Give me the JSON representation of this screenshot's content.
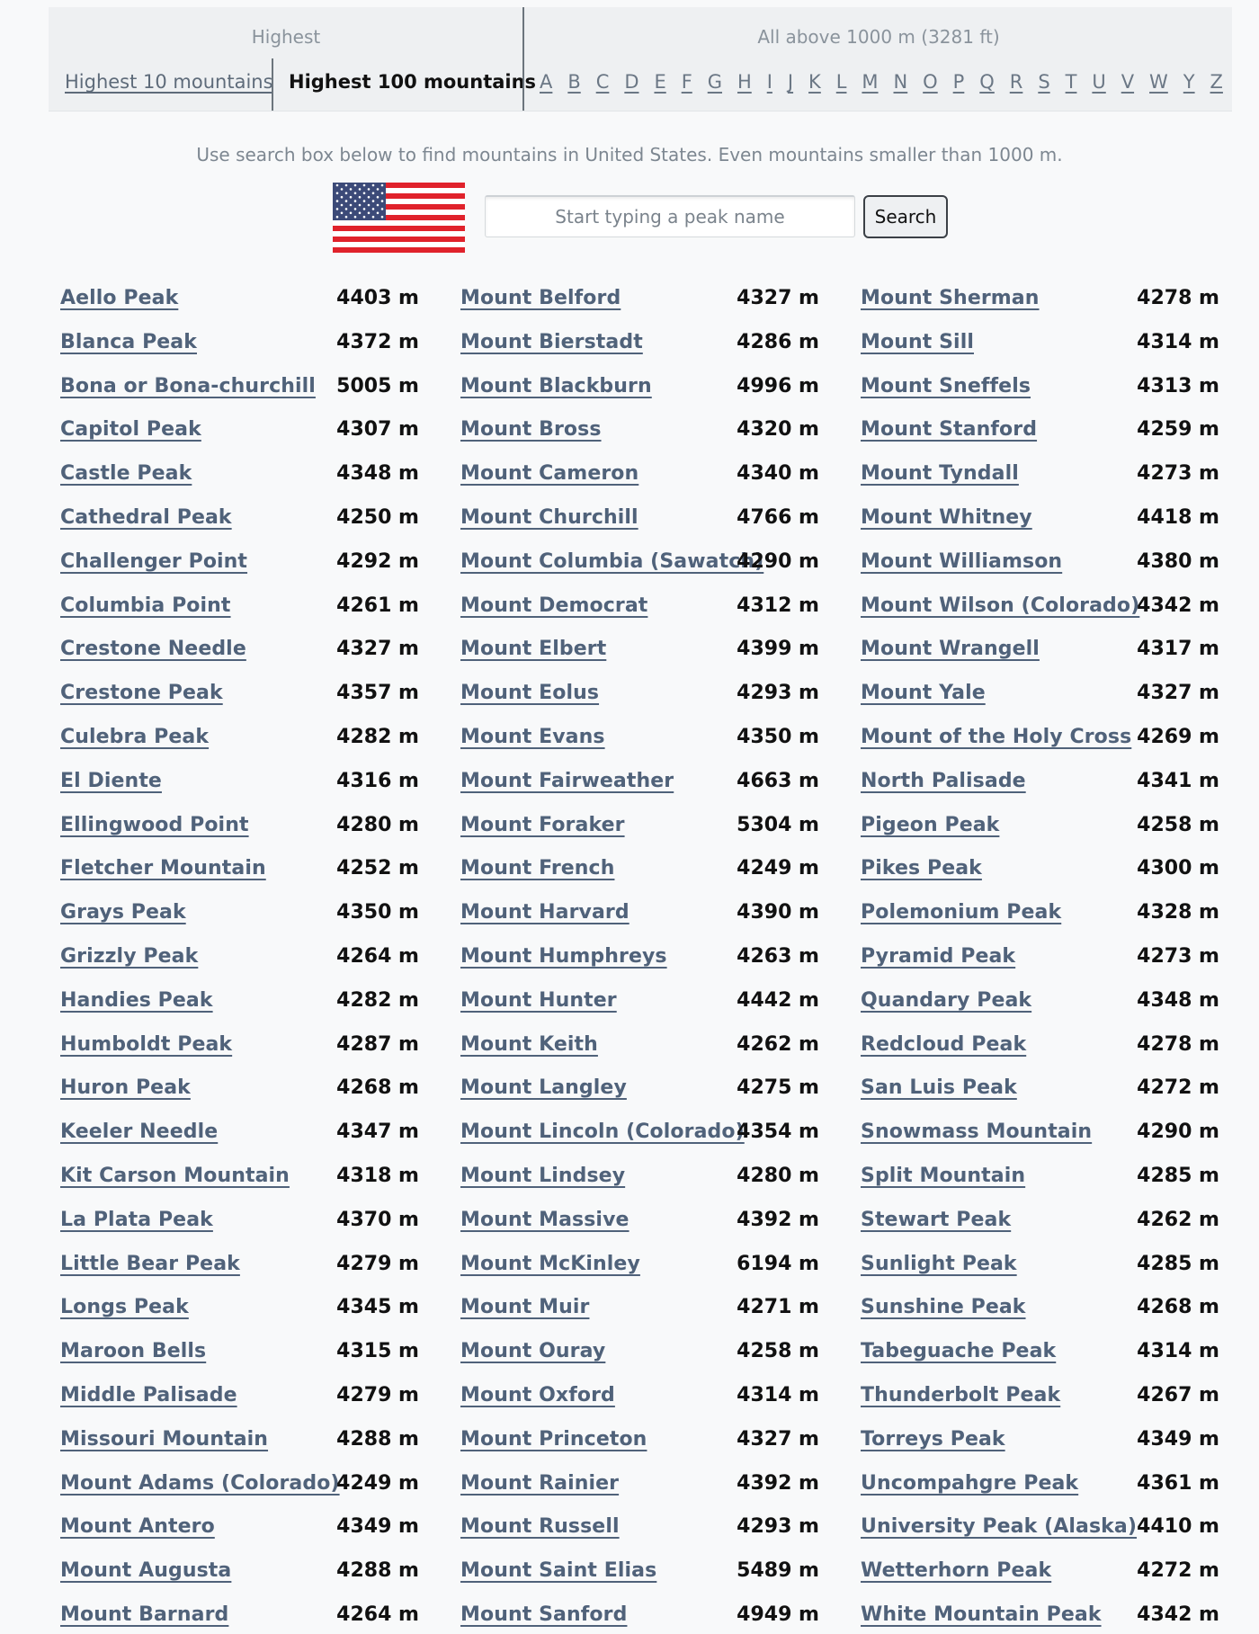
{
  "nav": {
    "highest_title": "Highest",
    "tab_top10": "Highest 10 mountains",
    "tab_top100": "Highest 100 mountains",
    "all_above_title": "All above 1000 m (3281 ft)",
    "letters": [
      "A",
      "B",
      "C",
      "D",
      "E",
      "F",
      "G",
      "H",
      "I",
      "J",
      "K",
      "L",
      "M",
      "N",
      "O",
      "P",
      "Q",
      "R",
      "S",
      "T",
      "U",
      "V",
      "W",
      "Y",
      "Z"
    ]
  },
  "search": {
    "hint": "Use search box below to find mountains in United States. Even mountains smaller than 1000 m.",
    "placeholder": "Start typing a peak name",
    "button_label": "Search"
  },
  "colors": {
    "link": "#50627a",
    "flag_red": "#e0222b",
    "flag_blue": "#3c4a78"
  },
  "columns": [
    [
      {
        "name": "Aello Peak",
        "height": "4403 m"
      },
      {
        "name": "Blanca Peak",
        "height": "4372 m"
      },
      {
        "name": "Bona or Bona-churchill",
        "height": "5005 m"
      },
      {
        "name": "Capitol Peak",
        "height": "4307 m"
      },
      {
        "name": "Castle Peak",
        "height": "4348 m"
      },
      {
        "name": "Cathedral Peak",
        "height": "4250 m"
      },
      {
        "name": "Challenger Point",
        "height": "4292 m"
      },
      {
        "name": "Columbia Point",
        "height": "4261 m"
      },
      {
        "name": "Crestone Needle",
        "height": "4327 m"
      },
      {
        "name": "Crestone Peak",
        "height": "4357 m"
      },
      {
        "name": "Culebra Peak",
        "height": "4282 m"
      },
      {
        "name": "El Diente",
        "height": "4316 m"
      },
      {
        "name": "Ellingwood Point",
        "height": "4280 m"
      },
      {
        "name": "Fletcher Mountain",
        "height": "4252 m"
      },
      {
        "name": "Grays Peak",
        "height": "4350 m"
      },
      {
        "name": "Grizzly Peak",
        "height": "4264 m"
      },
      {
        "name": "Handies Peak",
        "height": "4282 m"
      },
      {
        "name": "Humboldt Peak",
        "height": "4287 m"
      },
      {
        "name": "Huron Peak",
        "height": "4268 m"
      },
      {
        "name": "Keeler Needle",
        "height": "4347 m"
      },
      {
        "name": "Kit Carson Mountain",
        "height": "4318 m"
      },
      {
        "name": "La Plata Peak",
        "height": "4370 m"
      },
      {
        "name": "Little Bear Peak",
        "height": "4279 m"
      },
      {
        "name": "Longs Peak",
        "height": "4345 m"
      },
      {
        "name": "Maroon Bells",
        "height": "4315 m"
      },
      {
        "name": "Middle Palisade",
        "height": "4279 m"
      },
      {
        "name": "Missouri Mountain",
        "height": "4288 m"
      },
      {
        "name": "Mount Adams (Colorado)",
        "height": "4249 m"
      },
      {
        "name": "Mount Antero",
        "height": "4349 m"
      },
      {
        "name": "Mount Augusta",
        "height": "4288 m"
      },
      {
        "name": "Mount Barnard",
        "height": "4264 m"
      }
    ],
    [
      {
        "name": "Mount Belford",
        "height": "4327 m"
      },
      {
        "name": "Mount Bierstadt",
        "height": "4286 m"
      },
      {
        "name": "Mount Blackburn",
        "height": "4996 m"
      },
      {
        "name": "Mount Bross",
        "height": "4320 m"
      },
      {
        "name": "Mount Cameron",
        "height": "4340 m"
      },
      {
        "name": "Mount Churchill",
        "height": "4766 m"
      },
      {
        "name": "Mount Columbia (Sawatch)",
        "height": "4290 m"
      },
      {
        "name": "Mount Democrat",
        "height": "4312 m"
      },
      {
        "name": "Mount Elbert",
        "height": "4399 m"
      },
      {
        "name": "Mount Eolus",
        "height": "4293 m"
      },
      {
        "name": "Mount Evans",
        "height": "4350 m"
      },
      {
        "name": "Mount Fairweather",
        "height": "4663 m"
      },
      {
        "name": "Mount Foraker",
        "height": "5304 m"
      },
      {
        "name": "Mount French",
        "height": "4249 m"
      },
      {
        "name": "Mount Harvard",
        "height": "4390 m"
      },
      {
        "name": "Mount Humphreys",
        "height": "4263 m"
      },
      {
        "name": "Mount Hunter",
        "height": "4442 m"
      },
      {
        "name": "Mount Keith",
        "height": "4262 m"
      },
      {
        "name": "Mount Langley",
        "height": "4275 m"
      },
      {
        "name": "Mount Lincoln (Colorado)",
        "height": "4354 m"
      },
      {
        "name": "Mount Lindsey",
        "height": "4280 m"
      },
      {
        "name": "Mount Massive",
        "height": "4392 m"
      },
      {
        "name": "Mount McKinley",
        "height": "6194 m"
      },
      {
        "name": "Mount Muir",
        "height": "4271 m"
      },
      {
        "name": "Mount Ouray",
        "height": "4258 m"
      },
      {
        "name": "Mount Oxford",
        "height": "4314 m"
      },
      {
        "name": "Mount Princeton",
        "height": "4327 m"
      },
      {
        "name": "Mount Rainier",
        "height": "4392 m"
      },
      {
        "name": "Mount Russell",
        "height": "4293 m"
      },
      {
        "name": "Mount Saint Elias",
        "height": "5489 m"
      },
      {
        "name": "Mount Sanford",
        "height": "4949 m"
      }
    ],
    [
      {
        "name": "Mount Sherman",
        "height": "4278 m"
      },
      {
        "name": "Mount Sill",
        "height": "4314 m"
      },
      {
        "name": "Mount Sneffels",
        "height": "4313 m"
      },
      {
        "name": "Mount Stanford",
        "height": "4259 m"
      },
      {
        "name": "Mount Tyndall",
        "height": "4273 m"
      },
      {
        "name": "Mount Whitney",
        "height": "4418 m"
      },
      {
        "name": "Mount Williamson",
        "height": "4380 m"
      },
      {
        "name": "Mount Wilson (Colorado)",
        "height": "4342 m"
      },
      {
        "name": "Mount Wrangell",
        "height": "4317 m"
      },
      {
        "name": "Mount Yale",
        "height": "4327 m"
      },
      {
        "name": "Mount of the Holy Cross",
        "height": "4269 m"
      },
      {
        "name": "North Palisade",
        "height": "4341 m"
      },
      {
        "name": "Pigeon Peak",
        "height": "4258 m"
      },
      {
        "name": "Pikes Peak",
        "height": "4300 m"
      },
      {
        "name": "Polemonium Peak",
        "height": "4328 m"
      },
      {
        "name": "Pyramid Peak",
        "height": "4273 m"
      },
      {
        "name": "Quandary Peak",
        "height": "4348 m"
      },
      {
        "name": "Redcloud Peak",
        "height": "4278 m"
      },
      {
        "name": "San Luis Peak",
        "height": "4272 m"
      },
      {
        "name": "Snowmass Mountain",
        "height": "4290 m"
      },
      {
        "name": "Split Mountain",
        "height": "4285 m"
      },
      {
        "name": "Stewart Peak",
        "height": "4262 m"
      },
      {
        "name": "Sunlight Peak",
        "height": "4285 m"
      },
      {
        "name": "Sunshine Peak",
        "height": "4268 m"
      },
      {
        "name": "Tabeguache Peak",
        "height": "4314 m"
      },
      {
        "name": "Thunderbolt Peak",
        "height": "4267 m"
      },
      {
        "name": "Torreys Peak",
        "height": "4349 m"
      },
      {
        "name": "Uncompahgre Peak",
        "height": "4361 m"
      },
      {
        "name": "University Peak (Alaska)",
        "height": "4410 m"
      },
      {
        "name": "Wetterhorn Peak",
        "height": "4272 m"
      },
      {
        "name": "White Mountain Peak",
        "height": "4342 m"
      }
    ]
  ]
}
